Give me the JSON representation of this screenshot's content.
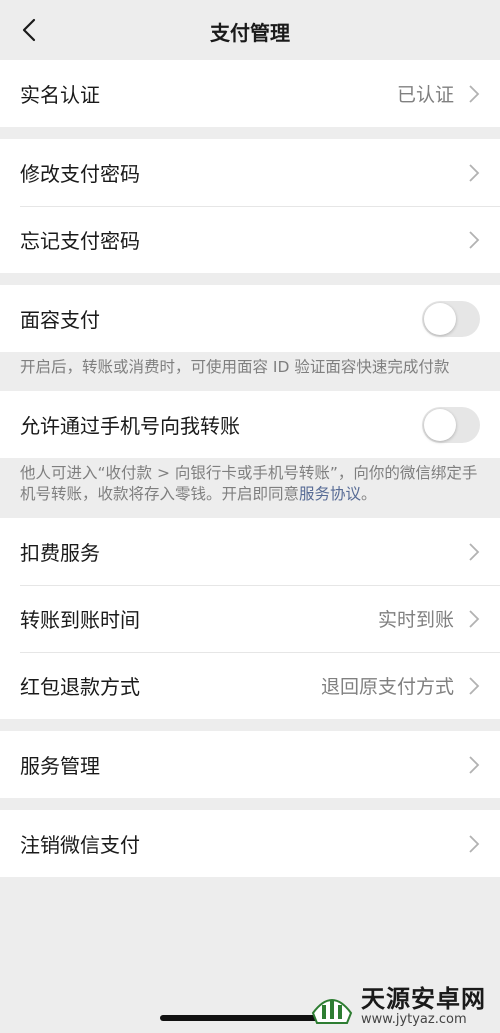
{
  "nav": {
    "title": "支付管理"
  },
  "verification": {
    "label": "实名认证",
    "value": "已认证"
  },
  "password": {
    "change_label": "修改支付密码",
    "forgot_label": "忘记支付密码"
  },
  "face_pay": {
    "label": "面容支付",
    "enabled": false,
    "desc": "开启后，转账或消费时，可使用面容 ID 验证面容快速完成付款"
  },
  "phone_transfer": {
    "label": "允许通过手机号向我转账",
    "enabled": false,
    "desc": "他人可进入“收付款 > 向银行卡或手机号转账”，向你的微信绑定手机号转账，收款将存入零钱。开启即同意",
    "link": "服务协议",
    "desc_end": "。"
  },
  "services": {
    "deduction_label": "扣费服务",
    "arrival_label": "转账到账时间",
    "arrival_value": "实时到账",
    "refund_label": "红包退款方式",
    "refund_value": "退回原支付方式"
  },
  "service_manage": {
    "label": "服务管理"
  },
  "cancel": {
    "label": "注销微信支付"
  },
  "watermark": {
    "title": "天源安卓网",
    "url": "www.jytyaz.com"
  },
  "colors": {
    "link": "#576b95",
    "background": "#ededed",
    "toggle_off": "#e6e6e6"
  }
}
